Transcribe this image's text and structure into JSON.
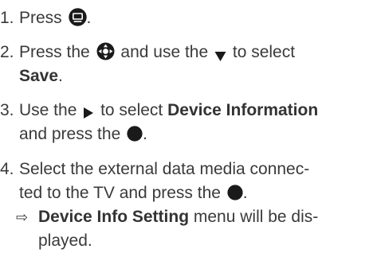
{
  "steps": [
    {
      "number": "1.",
      "line1_prefix": "Press",
      "line1_suffix": ".",
      "icon": "menu-icon"
    },
    {
      "number": "2.",
      "line1_prefix": "Press the",
      "line1_middle": "and use the",
      "line1_suffix": "to select",
      "line2_bold": "Save",
      "line2_suffix": ".",
      "icons": [
        "navigation-pad-icon",
        "down-arrow-icon"
      ]
    },
    {
      "number": "3.",
      "line1_prefix": "Use the",
      "line1_middle": "to select",
      "line1_bold": "Device Information",
      "line2_prefix": "and press the",
      "line2_suffix": ".",
      "icons": [
        "right-arrow-icon",
        "ok-button-icon"
      ]
    },
    {
      "number": "4.",
      "line1": "Select the external data media connec-",
      "line2_prefix": "ted to the TV and press the",
      "line2_suffix": ".",
      "icon": "ok-button-icon"
    }
  ],
  "result": {
    "arrow": "⇨",
    "line1_bold": "Device Info Setting",
    "line1_suffix": "menu will be dis-",
    "line2": "played."
  },
  "colors": {
    "text": "#3a3a3a",
    "icon": "#1a1a1a"
  }
}
